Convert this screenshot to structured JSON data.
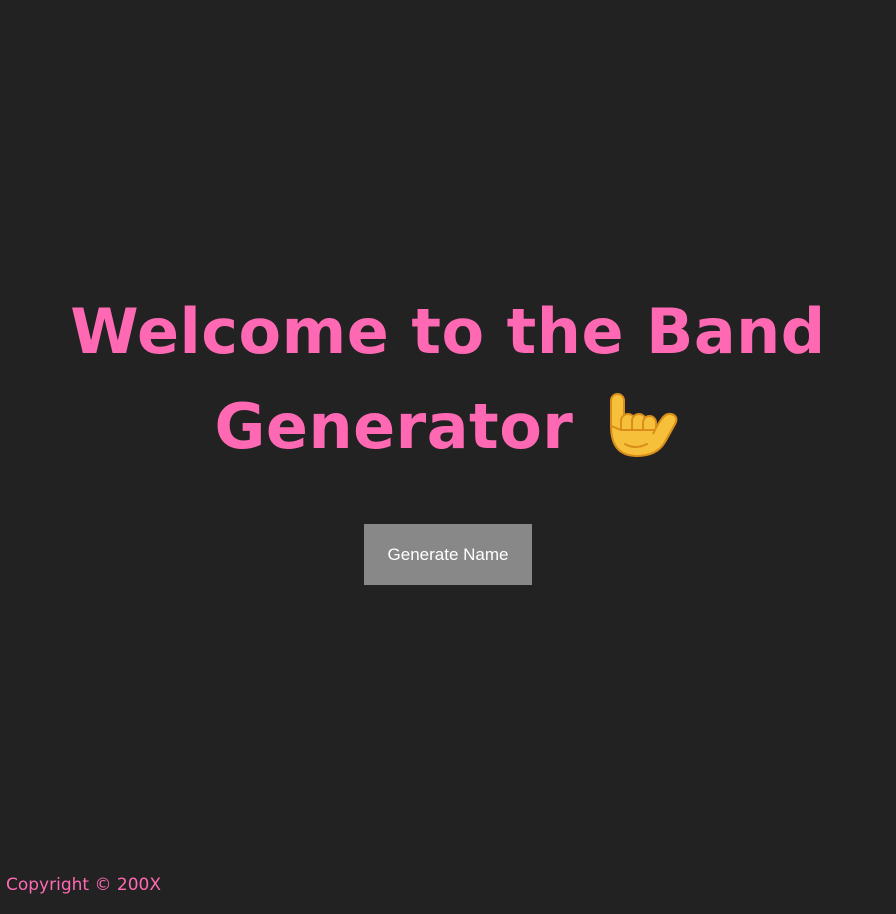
{
  "main": {
    "title_line1": "Welcome to the Band",
    "title_line2": "Generator",
    "title_icon": "call-me-hand-emoji",
    "generate_button_label": "Generate Name"
  },
  "footer": {
    "copyright": "Copyright © 200X"
  },
  "colors": {
    "background": "#222222",
    "accent": "#ff69b4",
    "button_bg": "#888888",
    "button_text": "#ffffff"
  }
}
